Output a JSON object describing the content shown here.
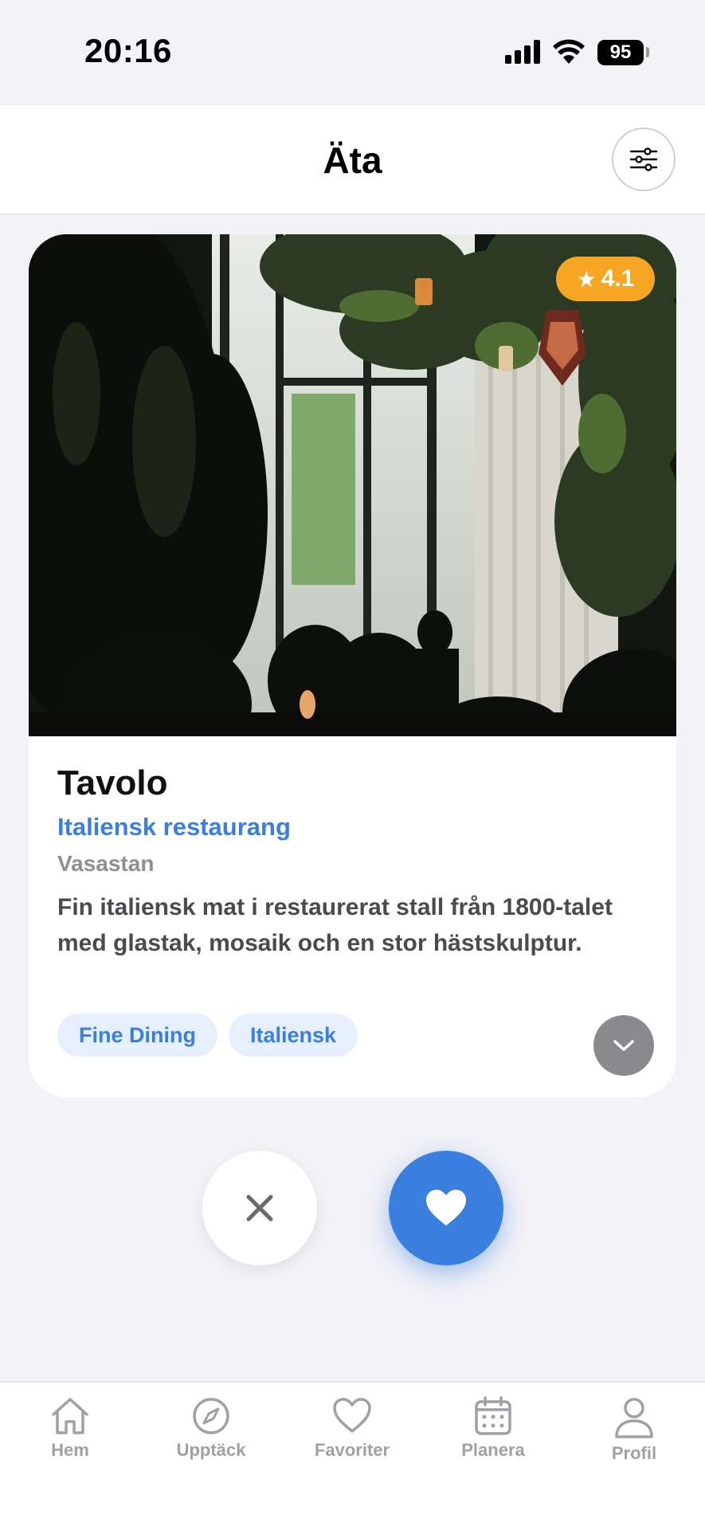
{
  "status_bar": {
    "time": "20:16",
    "battery": "95"
  },
  "header": {
    "title": "Äta",
    "filter_icon": "sliders-icon"
  },
  "card": {
    "rating": "4.1",
    "rating_icon": "star-icon",
    "name": "Tavolo",
    "category": "Italiensk restaurang",
    "area": "Vasastan",
    "description": "Fin italiensk mat i restaurerat stall från 1800-talet med glastak, mosaik och en stor hästskulptur.",
    "tags": [
      "Fine Dining",
      "Italiensk"
    ],
    "expand_icon": "chevron-down-icon"
  },
  "actions": {
    "dislike_icon": "close-icon",
    "like_icon": "heart-icon"
  },
  "tab_bar": {
    "items": [
      {
        "label": "Hem",
        "icon": "home-icon"
      },
      {
        "label": "Upptäck",
        "icon": "compass-icon"
      },
      {
        "label": "Favoriter",
        "icon": "heart-icon"
      },
      {
        "label": "Planera",
        "icon": "calendar-icon"
      },
      {
        "label": "Profil",
        "icon": "person-icon"
      }
    ]
  },
  "colors": {
    "accent": "#3a7fe0",
    "rating_badge": "#f6a623",
    "background": "#f2f2f7",
    "muted": "#a0a0a5"
  }
}
